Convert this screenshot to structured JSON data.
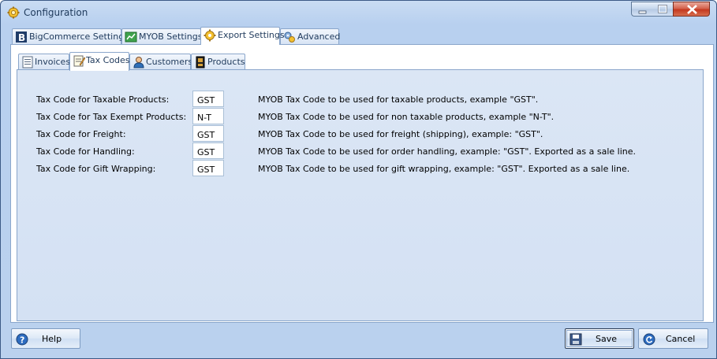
{
  "window": {
    "title": "Configuration"
  },
  "outer_tabs": [
    {
      "label": "BigCommerce Settings",
      "icon": "bigcommerce-icon",
      "active": false
    },
    {
      "label": "MYOB Settings",
      "icon": "myob-icon",
      "active": false
    },
    {
      "label": "Export Settings",
      "icon": "gear-icon",
      "active": true
    },
    {
      "label": "Advanced",
      "icon": "gears-icon",
      "active": false
    }
  ],
  "inner_tabs": [
    {
      "label": "Invoices",
      "icon": "invoice-icon",
      "active": false
    },
    {
      "label": "Tax Codes",
      "icon": "tax-codes-icon",
      "active": true
    },
    {
      "label": "Customers",
      "icon": "customer-icon",
      "active": false
    },
    {
      "label": "Products",
      "icon": "products-icon",
      "active": false
    }
  ],
  "tax_codes": [
    {
      "label": "Tax Code for Taxable Products:",
      "value": "GST",
      "description": "MYOB Tax Code to be used for taxable products, example \"GST\"."
    },
    {
      "label": "Tax Code for Tax Exempt Products:",
      "value": "N-T",
      "description": "MYOB Tax Code to be used for non taxable products, example \"N-T\"."
    },
    {
      "label": "Tax Code for Freight:",
      "value": "GST",
      "description": "MYOB Tax Code to be used for freight (shipping), example: \"GST\"."
    },
    {
      "label": "Tax Code for Handling:",
      "value": "GST",
      "description": "MYOB Tax Code to be used for order handling, example: \"GST\". Exported as a sale line."
    },
    {
      "label": "Tax Code for Gift Wrapping:",
      "value": "GST",
      "description": "MYOB Tax Code to be used for gift wrapping, example: \"GST\". Exported as a sale line."
    }
  ],
  "buttons": {
    "help": "Help",
    "save": "Save",
    "cancel": "Cancel"
  },
  "colors": {
    "accent": "#1e395b",
    "panel": "#d4e1f3",
    "window": "#bad1ee"
  }
}
